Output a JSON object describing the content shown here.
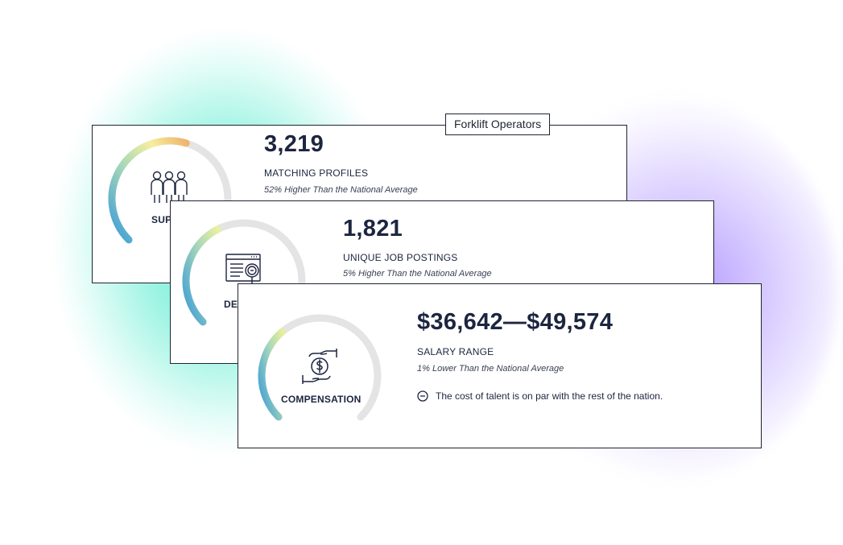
{
  "occupation_tag": "Forklift Operators",
  "cards": [
    {
      "category": "SUPPLY",
      "icon": "people-icon",
      "value": "3,219",
      "label": "MATCHING PROFILES",
      "comparison": "52% Higher Than the National Average",
      "gauge_level": 0.56
    },
    {
      "category": "DEMAND",
      "icon": "job-posting-search-icon",
      "value": "1,821",
      "label": "UNIQUE JOB POSTINGS",
      "comparison": "5% Higher Than the National Average",
      "gauge_level": 0.4
    },
    {
      "category": "COMPENSATION",
      "icon": "money-hands-icon",
      "value": "$36,642—$49,574",
      "label": "SALARY RANGE",
      "comparison": "1% Lower Than the National Average",
      "note": "The cost of talent is on par with the rest of the nation.",
      "note_icon": "minus-circle-icon",
      "gauge_level": 0.35
    }
  ],
  "colors": {
    "text": "#1c2540",
    "gauge_track": "#e4e4e4",
    "gauge_start": "#3a9bd8",
    "gauge_mid": "#a8d8b8",
    "gauge_yellow": "#f6ef9e",
    "gauge_orange": "#efb36e"
  }
}
